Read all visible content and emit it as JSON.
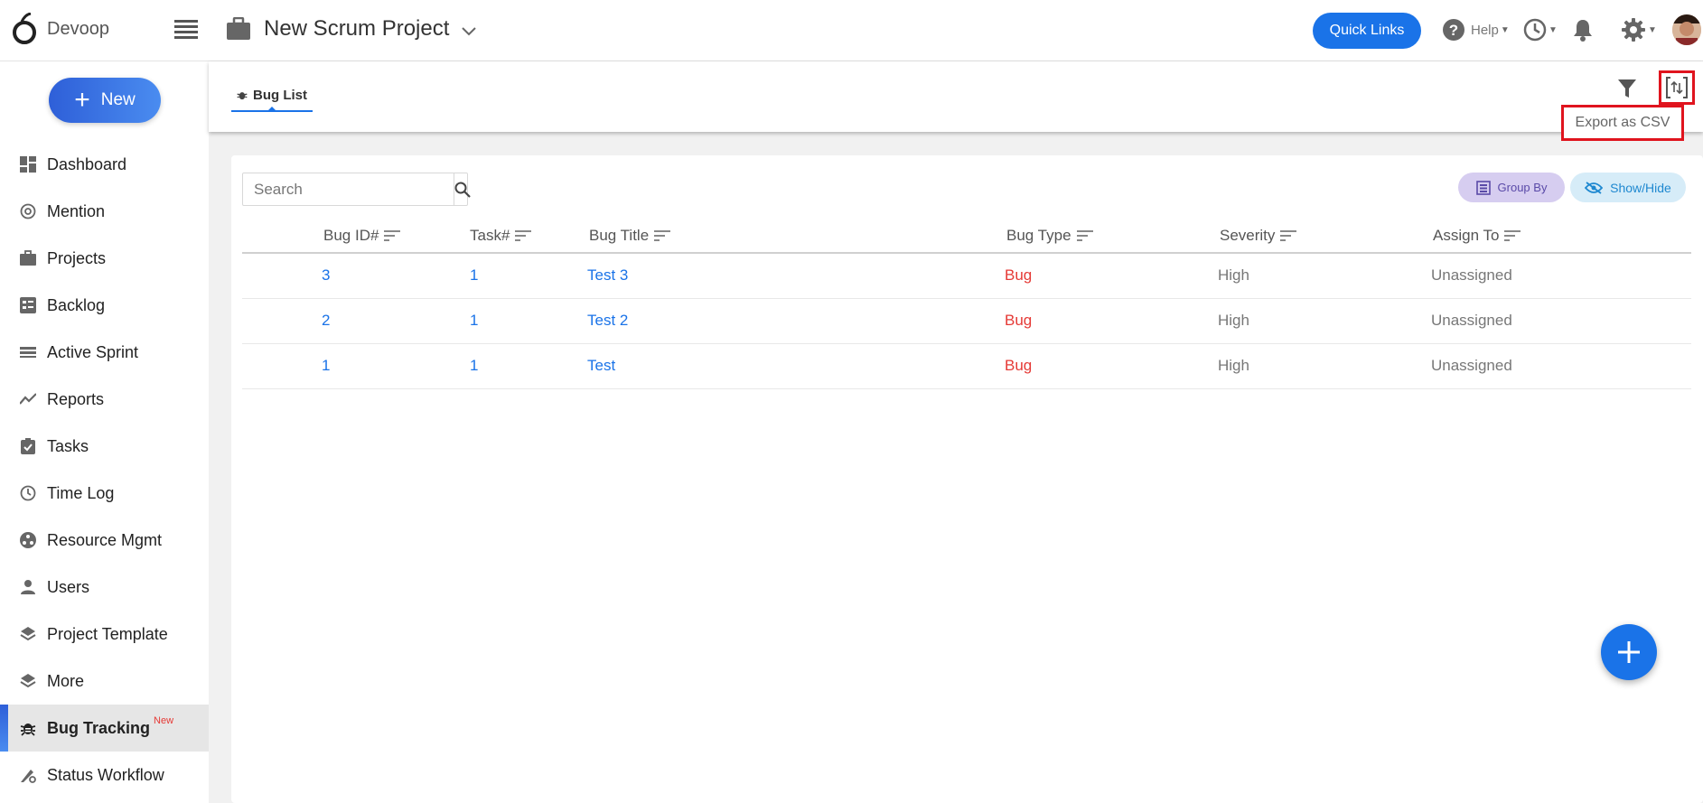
{
  "app": {
    "logo_text": "Devoop"
  },
  "header": {
    "project_title": "New Scrum Project",
    "quick_links_label": "Quick Links",
    "help_label": "Help"
  },
  "sidebar": {
    "new_label": "New",
    "items": [
      {
        "label": "Dashboard",
        "icon": "dashboard-icon"
      },
      {
        "label": "Mention",
        "icon": "at-icon"
      },
      {
        "label": "Projects",
        "icon": "briefcase-icon"
      },
      {
        "label": "Backlog",
        "icon": "backlog-icon"
      },
      {
        "label": "Active Sprint",
        "icon": "sprint-icon"
      },
      {
        "label": "Reports",
        "icon": "trend-icon"
      },
      {
        "label": "Tasks",
        "icon": "clipboard-check-icon"
      },
      {
        "label": "Time Log",
        "icon": "clock-icon"
      },
      {
        "label": "Resource Mgmt",
        "icon": "resource-icon"
      },
      {
        "label": "Users",
        "icon": "user-icon"
      },
      {
        "label": "Project Template",
        "icon": "layers-icon"
      },
      {
        "label": "More",
        "icon": "layers-icon"
      },
      {
        "label": "Bug Tracking",
        "icon": "bug-icon",
        "badge": "New",
        "active": true
      },
      {
        "label": "Status Workflow",
        "icon": "workflow-icon"
      }
    ]
  },
  "tabs": {
    "bug_list_label": "Bug List"
  },
  "export_menu": {
    "export_csv_label": "Export as CSV"
  },
  "toolbar": {
    "search_placeholder": "Search",
    "group_by_label": "Group By",
    "show_hide_label": "Show/Hide"
  },
  "table": {
    "columns": [
      "Bug ID#",
      "Task#",
      "Bug Title",
      "Bug Type",
      "Severity",
      "Assign To"
    ],
    "rows": [
      {
        "bug_id": "3",
        "task": "1",
        "title": "Test 3",
        "type": "Bug",
        "severity": "High",
        "assign": "Unassigned"
      },
      {
        "bug_id": "2",
        "task": "1",
        "title": "Test 2",
        "type": "Bug",
        "severity": "High",
        "assign": "Unassigned"
      },
      {
        "bug_id": "1",
        "task": "1",
        "title": "Test",
        "type": "Bug",
        "severity": "High",
        "assign": "Unassigned"
      }
    ]
  },
  "colors": {
    "accent": "#1a73e8",
    "highlight": "#e0141e",
    "bug_red": "#e53935"
  }
}
